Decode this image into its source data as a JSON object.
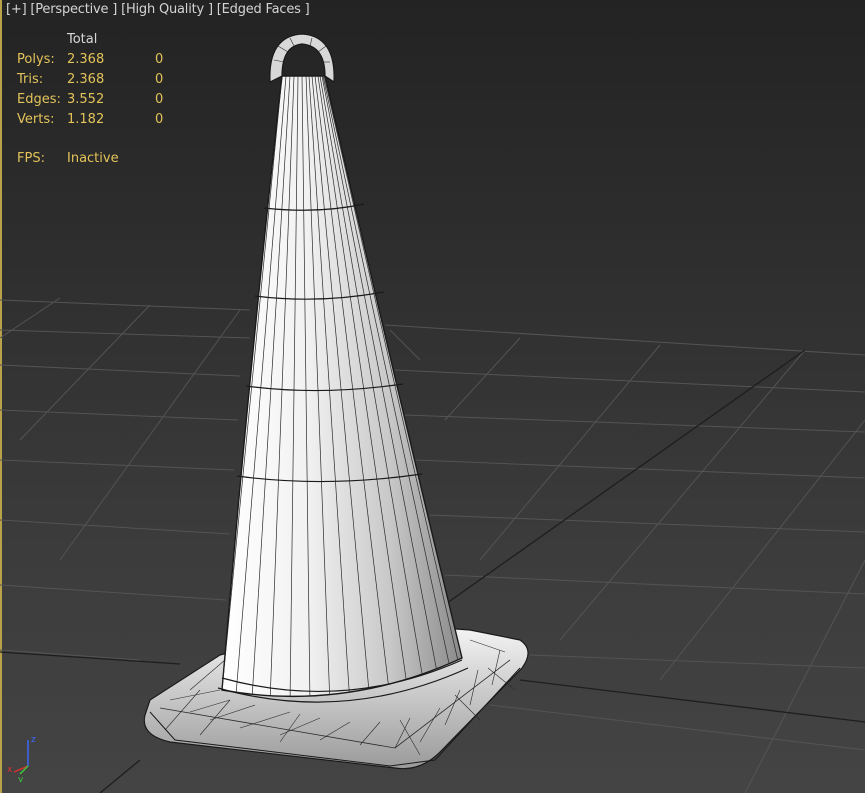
{
  "viewport": {
    "labels": {
      "plus": "[+]",
      "view": "[Perspective ]",
      "shading": "[High Quality ]",
      "edges": "[Edged Faces ]"
    },
    "stats": {
      "header": "Total",
      "rows": [
        {
          "label": "Polys:",
          "total": "2.368",
          "selected": "0"
        },
        {
          "label": "Tris:",
          "total": "2.368",
          "selected": "0"
        },
        {
          "label": "Edges:",
          "total": "3.552",
          "selected": "0"
        },
        {
          "label": "Verts:",
          "total": "1.182",
          "selected": "0"
        }
      ],
      "fps_label": "FPS:",
      "fps_value": "Inactive"
    },
    "gizmo": {
      "x_label": "x",
      "y_label": "y",
      "z_label": "z"
    }
  },
  "colors": {
    "label_text": "#d4d4d4",
    "stats_text": "#e3c45a",
    "grid_line": "#4c4c4c",
    "mesh_fill": "#e6e6e6",
    "mesh_wire": "#1a1a1a",
    "axis_x": "#e03030",
    "axis_y": "#3ccc3c",
    "axis_z": "#3a6cff"
  }
}
